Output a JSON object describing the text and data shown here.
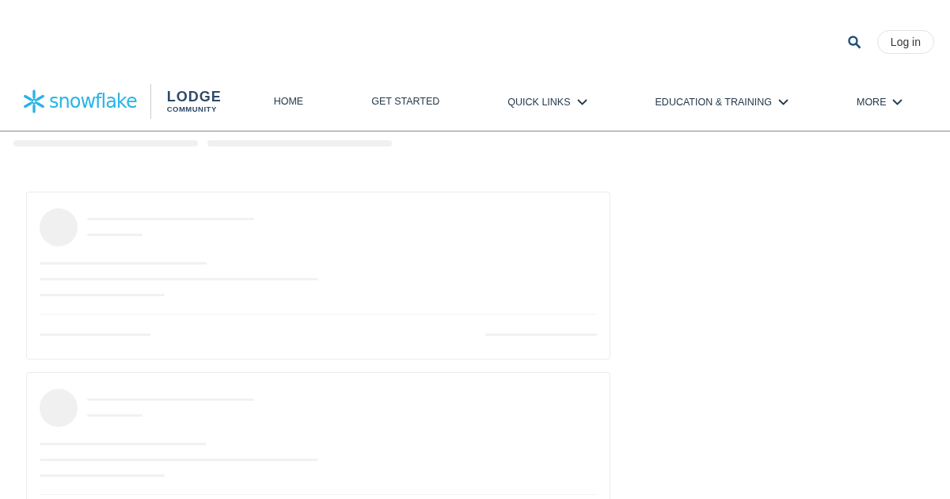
{
  "header": {
    "login": "Log in"
  },
  "logo": {
    "brand": "snowflake",
    "title": "LODGE",
    "subtitle": "COMMUNITY"
  },
  "nav": [
    {
      "label": "HOME",
      "kind": "link"
    },
    {
      "label": "GET STARTED",
      "kind": "link"
    },
    {
      "label": "QUICK LINKS",
      "kind": "dropdown"
    },
    {
      "label": "EDUCATION & TRAINING",
      "kind": "dropdown"
    },
    {
      "label": "MORE",
      "kind": "dropdown"
    }
  ],
  "breadcrumb_placeholders": [
    {
      "kind": "bar"
    },
    {
      "kind": "bar"
    }
  ],
  "placeholder_cards": [
    {
      "kind": "post"
    },
    {
      "kind": "post"
    }
  ]
}
